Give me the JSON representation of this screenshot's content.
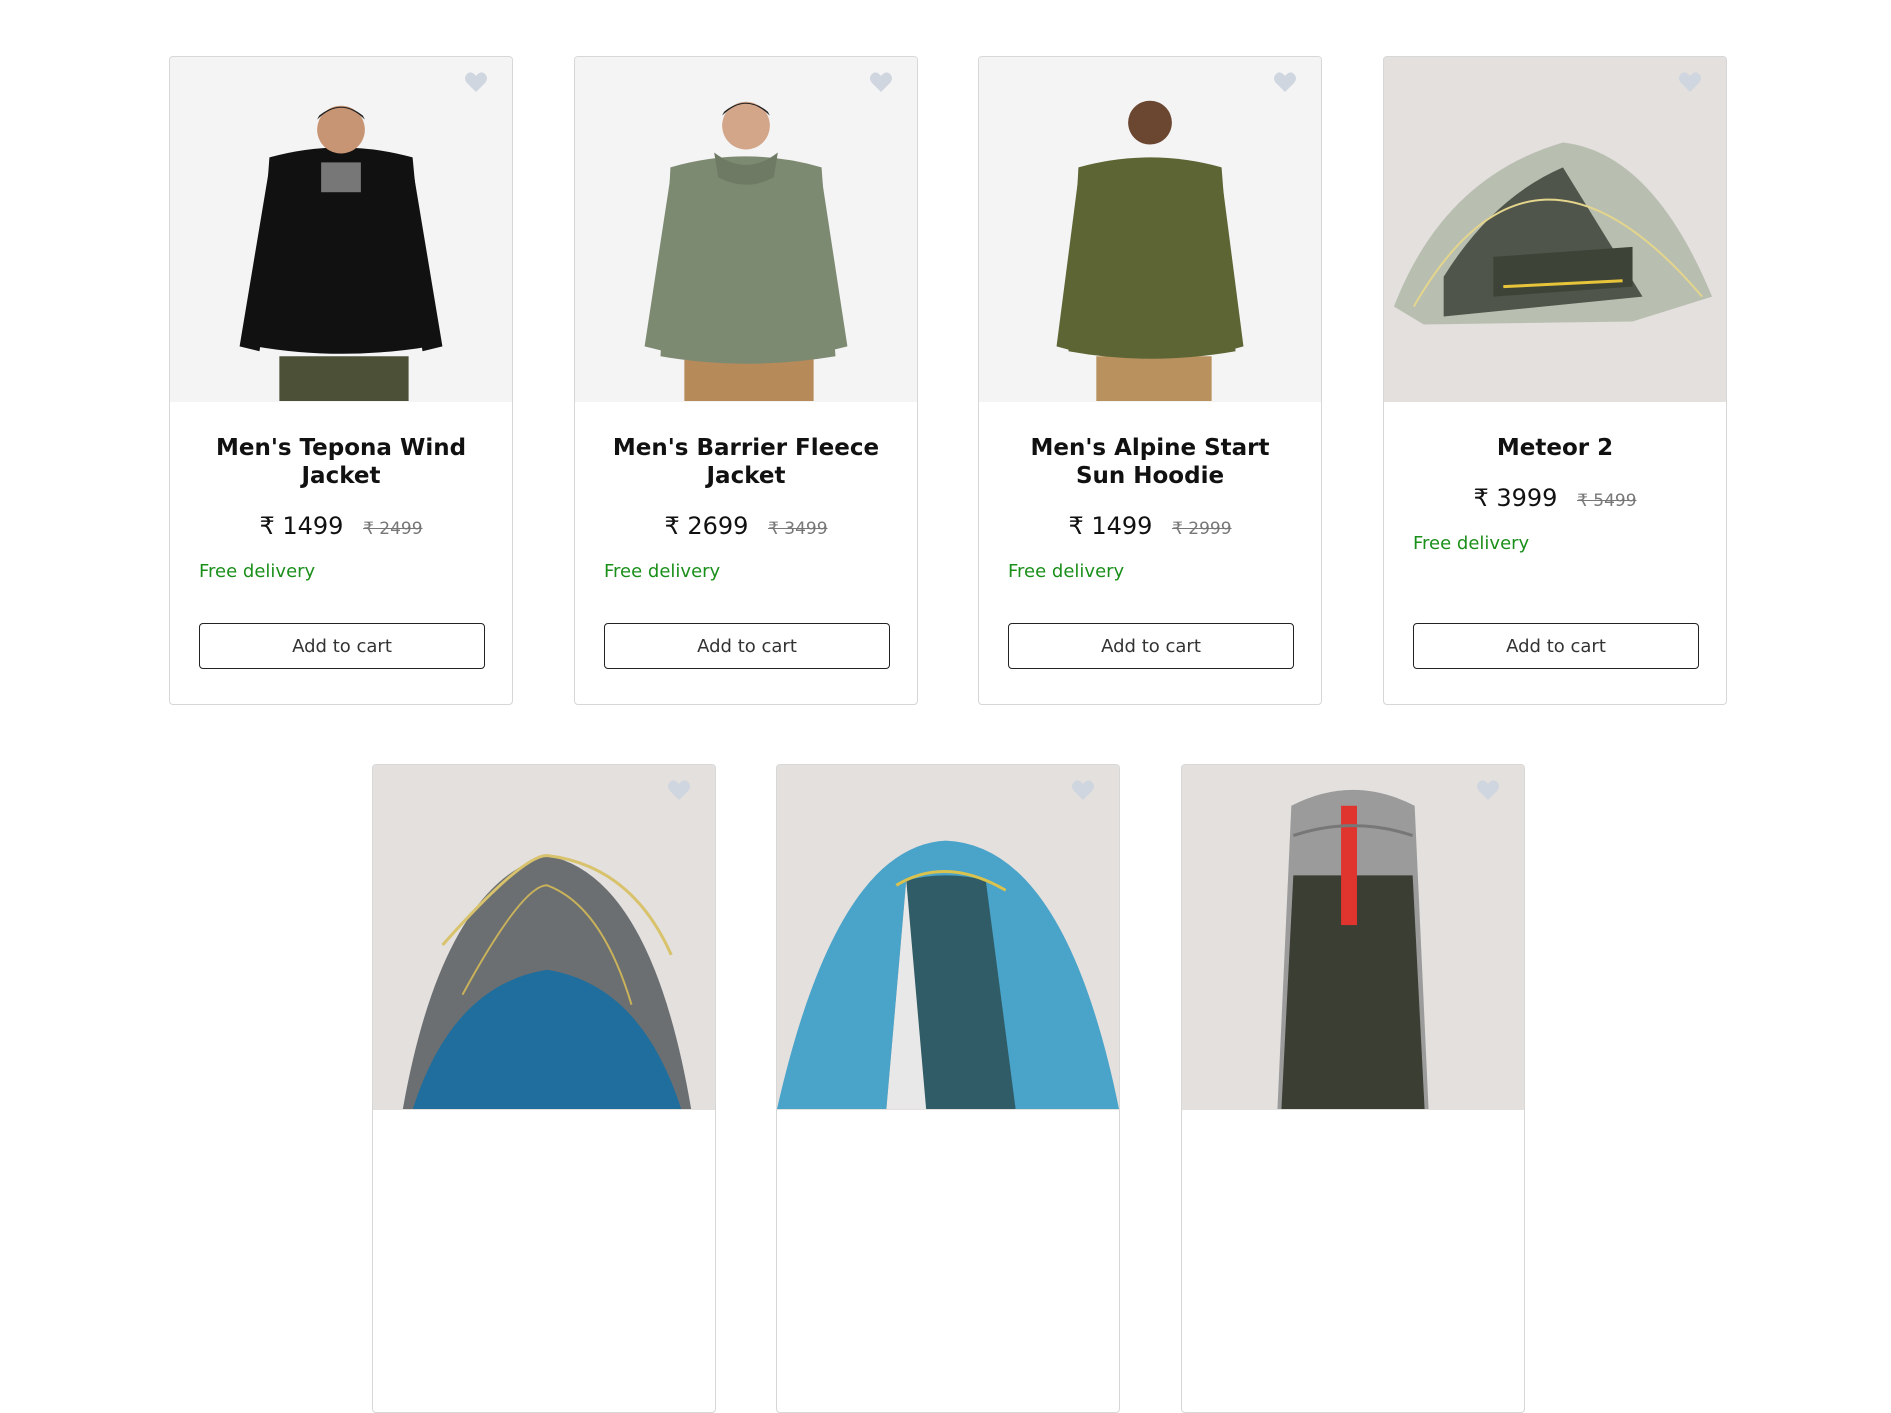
{
  "products": [
    {
      "name": "Men's Tepona Wind Jacket",
      "price": "₹ 1499",
      "mrp": "₹ 2499",
      "delivery": "Free delivery",
      "cart_label": "Add to cart",
      "image": "black-hoodie-model",
      "accent": "#111111"
    },
    {
      "name": "Men's Barrier Fleece Jacket",
      "price": "₹ 2699",
      "mrp": "₹ 3499",
      "delivery": "Free delivery",
      "cart_label": "Add to cart",
      "image": "sage-hoodie-model",
      "accent": "#7d8a72"
    },
    {
      "name": "Men's Alpine Start Sun Hoodie",
      "price": "₹ 1499",
      "mrp": "₹ 2999",
      "delivery": "Free delivery",
      "cart_label": "Add to cart",
      "image": "olive-hoodie-model",
      "accent": "#5d6534"
    },
    {
      "name": "Meteor 2",
      "price": "₹ 3999",
      "mrp": "₹ 5499",
      "delivery": "Free delivery",
      "cart_label": "Add to cart",
      "image": "grey-dome-tent",
      "accent": "#9aa08e"
    },
    {
      "name": "",
      "image": "blue-grey-dome-tent",
      "accent": "#2c6f9a"
    },
    {
      "name": "",
      "image": "teal-dome-tent",
      "accent": "#4aa3c9"
    },
    {
      "name": "",
      "image": "grey-backpack",
      "accent": "#9b9b9b"
    }
  ],
  "icons": {
    "favorite": "heart-icon"
  },
  "colors": {
    "delivery_green": "#1a8f1a",
    "heart": "#cfd6df",
    "border": "#d7d7d7"
  }
}
